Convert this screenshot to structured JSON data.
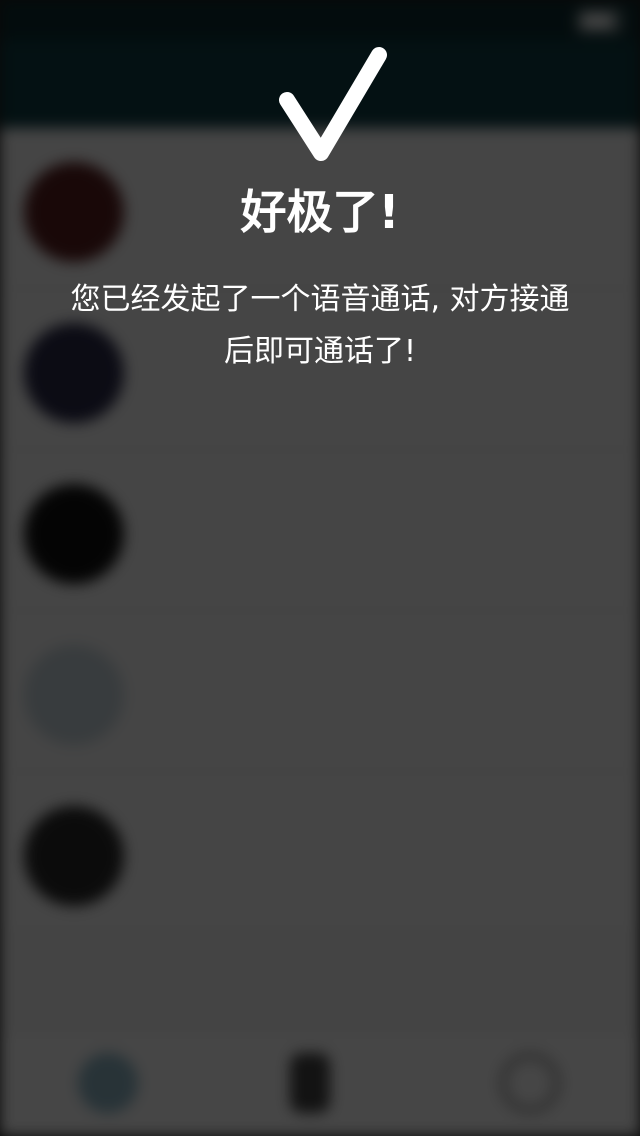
{
  "status_bar": {
    "carrier": "",
    "time": "",
    "battery_icon": "battery-icon"
  },
  "nav": {
    "title": ""
  },
  "contacts": [
    {
      "name": "",
      "subtitle": "",
      "time": "",
      "avatar_color": "#5a1f1f"
    },
    {
      "name": "",
      "subtitle": "",
      "time": "",
      "avatar_color": "#2b2b4a"
    },
    {
      "name": "",
      "subtitle": "",
      "time": "",
      "avatar_color": "#111111"
    },
    {
      "name": "",
      "subtitle": "",
      "time": "",
      "avatar_color": "#c9d6dd"
    },
    {
      "name": "",
      "subtitle": "",
      "time": "",
      "avatar_color": "#2a2a2a"
    }
  ],
  "tabs": [
    {
      "label": "",
      "icon": "chat-icon"
    },
    {
      "label": "",
      "icon": "phone-icon"
    },
    {
      "label": "",
      "icon": "profile-icon"
    }
  ],
  "dialog": {
    "title": "好极了!",
    "message_line1": "您已经发起了一个语音通话, 对方接通",
    "message_line2": "后即可通话了!",
    "icon": "checkmark-icon",
    "accent": "#ffffff"
  }
}
